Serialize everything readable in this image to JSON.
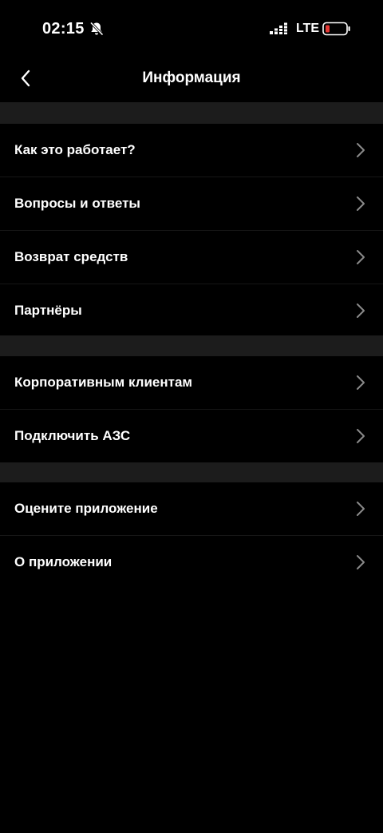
{
  "status_bar": {
    "time": "02:15",
    "network": "LTE",
    "icons": [
      "bell-off-icon",
      "signal-icon",
      "battery-low-icon"
    ]
  },
  "header": {
    "title": "Информация",
    "back_icon": "chevron-left-icon"
  },
  "sections": [
    {
      "items": [
        {
          "label": "Как это работает?"
        },
        {
          "label": "Вопросы и ответы"
        },
        {
          "label": "Возврат средств"
        },
        {
          "label": "Партнёры"
        }
      ]
    },
    {
      "items": [
        {
          "label": "Корпоративным клиентам"
        },
        {
          "label": "Подключить АЗС"
        }
      ]
    },
    {
      "items": [
        {
          "label": "Оцените приложение"
        },
        {
          "label": "О приложении"
        }
      ]
    }
  ],
  "colors": {
    "background": "#000000",
    "separator_band": "#1c1c1c",
    "text": "#ffffff",
    "chevron": "#8a8a8a",
    "battery_low": "#e53935"
  }
}
